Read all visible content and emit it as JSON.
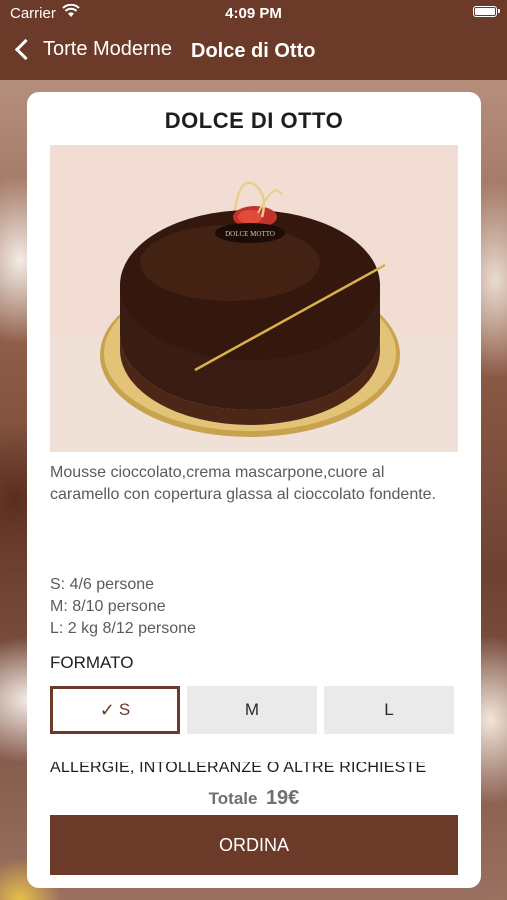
{
  "status_bar": {
    "carrier": "Carrier",
    "time": "4:09 PM"
  },
  "nav": {
    "back_label": "Torte Moderne",
    "title": "Dolce di Otto"
  },
  "product": {
    "name": "DOLCE DI OTTO",
    "description": "Mousse cioccolato,crema mascarpone,cuore al caramello con copertura glassa al cioccolato fondente.",
    "sizes": [
      "S: 4/6 persone",
      "M: 8/10 persone",
      "L: 2 kg 8/12 persone"
    ]
  },
  "format": {
    "label": "FORMATO",
    "options": [
      {
        "label": "S",
        "selected": true
      },
      {
        "label": "M",
        "selected": false
      },
      {
        "label": "L",
        "selected": false
      }
    ]
  },
  "allergies_label": "ALLERGIE, INTOLLERANZE O ALTRE RICHIESTE",
  "total": {
    "label": "Totale",
    "value": "19€"
  },
  "order_button": "ORDINA",
  "colors": {
    "brand": "#6b3a28",
    "selected_border": "#6b3a28",
    "option_bg": "#eaeaea"
  }
}
